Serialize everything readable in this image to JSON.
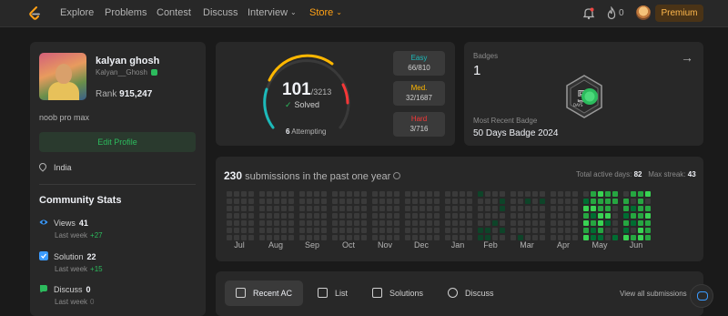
{
  "nav": {
    "items": [
      {
        "label": "Explore"
      },
      {
        "label": "Problems"
      },
      {
        "label": "Contest"
      },
      {
        "label": "Discuss"
      },
      {
        "label": "Interview",
        "caret": "⌄"
      },
      {
        "label": "Store",
        "caret": "⌄"
      }
    ],
    "streak_count": "0",
    "premium_label": "Premium",
    "colors": {
      "accent": "#ffa116",
      "premium_text": "#ffb84d"
    }
  },
  "profile": {
    "name": "kalyan ghosh",
    "username": "Kalyan__Ghosh",
    "rank_label": "Rank",
    "rank_value": "915,247",
    "bio": "noob pro max",
    "edit_label": "Edit Profile",
    "location": "India"
  },
  "community": {
    "title": "Community Stats",
    "stats": [
      {
        "label": "Views",
        "value": "41",
        "sub_label": "Last week",
        "sub_value": "+27",
        "icon": "eye-icon",
        "color": "#3b9bff"
      },
      {
        "label": "Solution",
        "value": "22",
        "sub_label": "Last week",
        "sub_value": "+15",
        "icon": "check-square-icon",
        "color": "#3b9bff"
      },
      {
        "label": "Discuss",
        "value": "0",
        "sub_label": "Last week",
        "sub_value": "0",
        "icon": "chat-icon",
        "color": "#2cbb5d"
      }
    ]
  },
  "solved": {
    "count": "101",
    "total": "/3213",
    "label": "Solved",
    "attempting_count": "6",
    "attempting_label": "Attempting",
    "difficulties": [
      {
        "label": "Easy",
        "value": "66/810",
        "color": "#1cbaba"
      },
      {
        "label": "Med.",
        "value": "32/1687",
        "color": "#ffb700"
      },
      {
        "label": "Hard",
        "value": "3/716",
        "color": "#f63737"
      }
    ]
  },
  "badges": {
    "label": "Badges",
    "count": "1",
    "recent_label": "Most Recent Badge",
    "recent_name": "50 Days Badge 2024",
    "badge_icon": "50-days-badge-icon"
  },
  "submissions": {
    "count": "230",
    "label": "submissions in the past one year",
    "total_active_label": "Total active days:",
    "total_active_value": "82",
    "max_streak_label": "Max streak:",
    "max_streak_value": "43",
    "months": [
      "Jul",
      "Aug",
      "Sep",
      "Oct",
      "Nov",
      "Dec",
      "Jan",
      "Feb",
      "Mar",
      "Apr",
      "May",
      "Jun"
    ]
  },
  "tabs": {
    "items": [
      {
        "label": "Recent AC",
        "icon": "recent-ac-icon"
      },
      {
        "label": "List",
        "icon": "list-icon"
      },
      {
        "label": "Solutions",
        "icon": "solutions-icon"
      },
      {
        "label": "Discuss",
        "icon": "discuss-icon"
      }
    ],
    "view_all": "View all submissions"
  }
}
